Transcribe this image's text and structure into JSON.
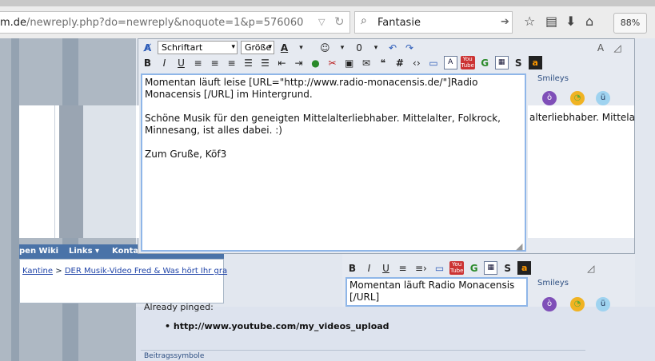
{
  "browser": {
    "url_domain": "m.de",
    "url_path": "/newreply.php?do=newreply&noquote=1&p=576060",
    "search_value": "Fantasie",
    "zoom": "88%"
  },
  "toolbar": {
    "font_select": "Schriftart",
    "size_select": "Größe"
  },
  "editor": {
    "text": "Momentan läuft leise [URL=\"http://www.radio-monacensis.de/\"]Radio Monacensis [/URL] im Hintergrund.\n\nSchöne Musik für den geneigten Mittelalterliebhaber. Mittelalter, Folkrock, Minnesang, ist alles dabei. :)\n\nZum Gruße, Köf3",
    "smileys_title": "Smileys"
  },
  "overlay": {
    "text": "alterliebhaber. Mittela"
  },
  "navbar": {
    "items": [
      "pen Wiki",
      "Links ▾",
      "Kontak"
    ]
  },
  "breadcrumb": {
    "sep": ">",
    "item1": "Kantine",
    "item2": "DER Musik-Video Fred & Was hört Ihr gra"
  },
  "editor2": {
    "text": "Momentan läuft Radio Monacensis [/URL]",
    "smileys_title": "Smileys"
  },
  "lower": {
    "pinged": "Already pinged:",
    "bullet": "http://www.youtube.com/my_videos_upload",
    "symbols_title": "Beitragssymbole"
  }
}
